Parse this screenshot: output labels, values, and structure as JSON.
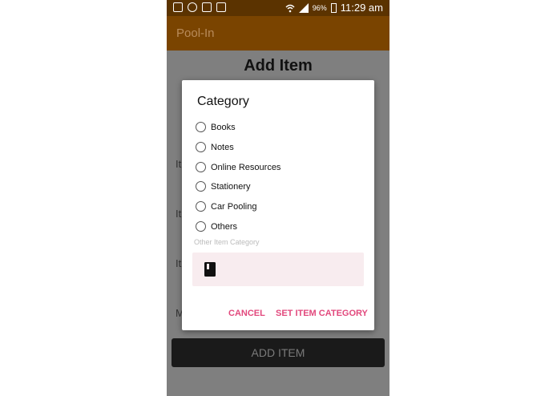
{
  "status_bar": {
    "battery": "96%",
    "time": "11:29 am"
  },
  "app": {
    "title": "Pool-In"
  },
  "page": {
    "title": "Add Item",
    "bg_labels": [
      "It",
      "It",
      "It",
      "M"
    ],
    "add_button": "ADD ITEM"
  },
  "dialog": {
    "title": "Category",
    "options": [
      {
        "label": "Books",
        "selected": false
      },
      {
        "label": "Notes",
        "selected": false
      },
      {
        "label": "Online Resources",
        "selected": false
      },
      {
        "label": "Stationery",
        "selected": false
      },
      {
        "label": "Car Pooling",
        "selected": false
      },
      {
        "label": "Others",
        "selected": false
      }
    ],
    "other_field_label": "Other Item Category",
    "other_field_value": "",
    "cancel_label": "CANCEL",
    "confirm_label": "SET ITEM CATEGORY"
  },
  "colors": {
    "status_bar": "#5b3300",
    "app_bar": "#7a4400",
    "accent": "#e2497d",
    "field_bg": "#f8ecef"
  }
}
